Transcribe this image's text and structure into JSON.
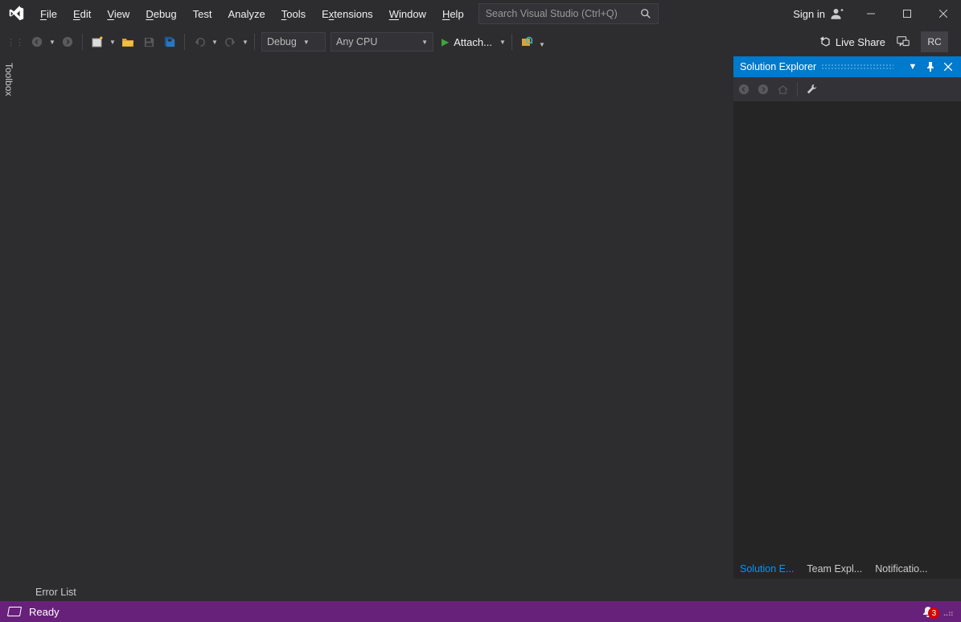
{
  "menu": {
    "items": [
      {
        "label": "File",
        "accel": "F"
      },
      {
        "label": "Edit",
        "accel": "E"
      },
      {
        "label": "View",
        "accel": "V"
      },
      {
        "label": "Debug",
        "accel": "D"
      },
      {
        "label": "Test",
        "accel": ""
      },
      {
        "label": "Analyze",
        "accel": ""
      },
      {
        "label": "Tools",
        "accel": "T"
      },
      {
        "label": "Extensions",
        "accel": "x"
      },
      {
        "label": "Window",
        "accel": "W"
      },
      {
        "label": "Help",
        "accel": "H"
      }
    ]
  },
  "search": {
    "placeholder": "Search Visual Studio (Ctrl+Q)"
  },
  "signin": {
    "label": "Sign in"
  },
  "toolbar": {
    "config": "Debug",
    "platform": "Any CPU",
    "attach": "Attach..."
  },
  "liveshare": {
    "label": "Live Share"
  },
  "badge": "RC",
  "leftRail": {
    "toolbox": "Toolbox"
  },
  "solutionExplorer": {
    "title": "Solution Explorer",
    "tabs": [
      "Solution E...",
      "Team Expl...",
      "Notificatio..."
    ]
  },
  "bottom": {
    "errorList": "Error List"
  },
  "status": {
    "ready": "Ready",
    "notifications": "3"
  }
}
